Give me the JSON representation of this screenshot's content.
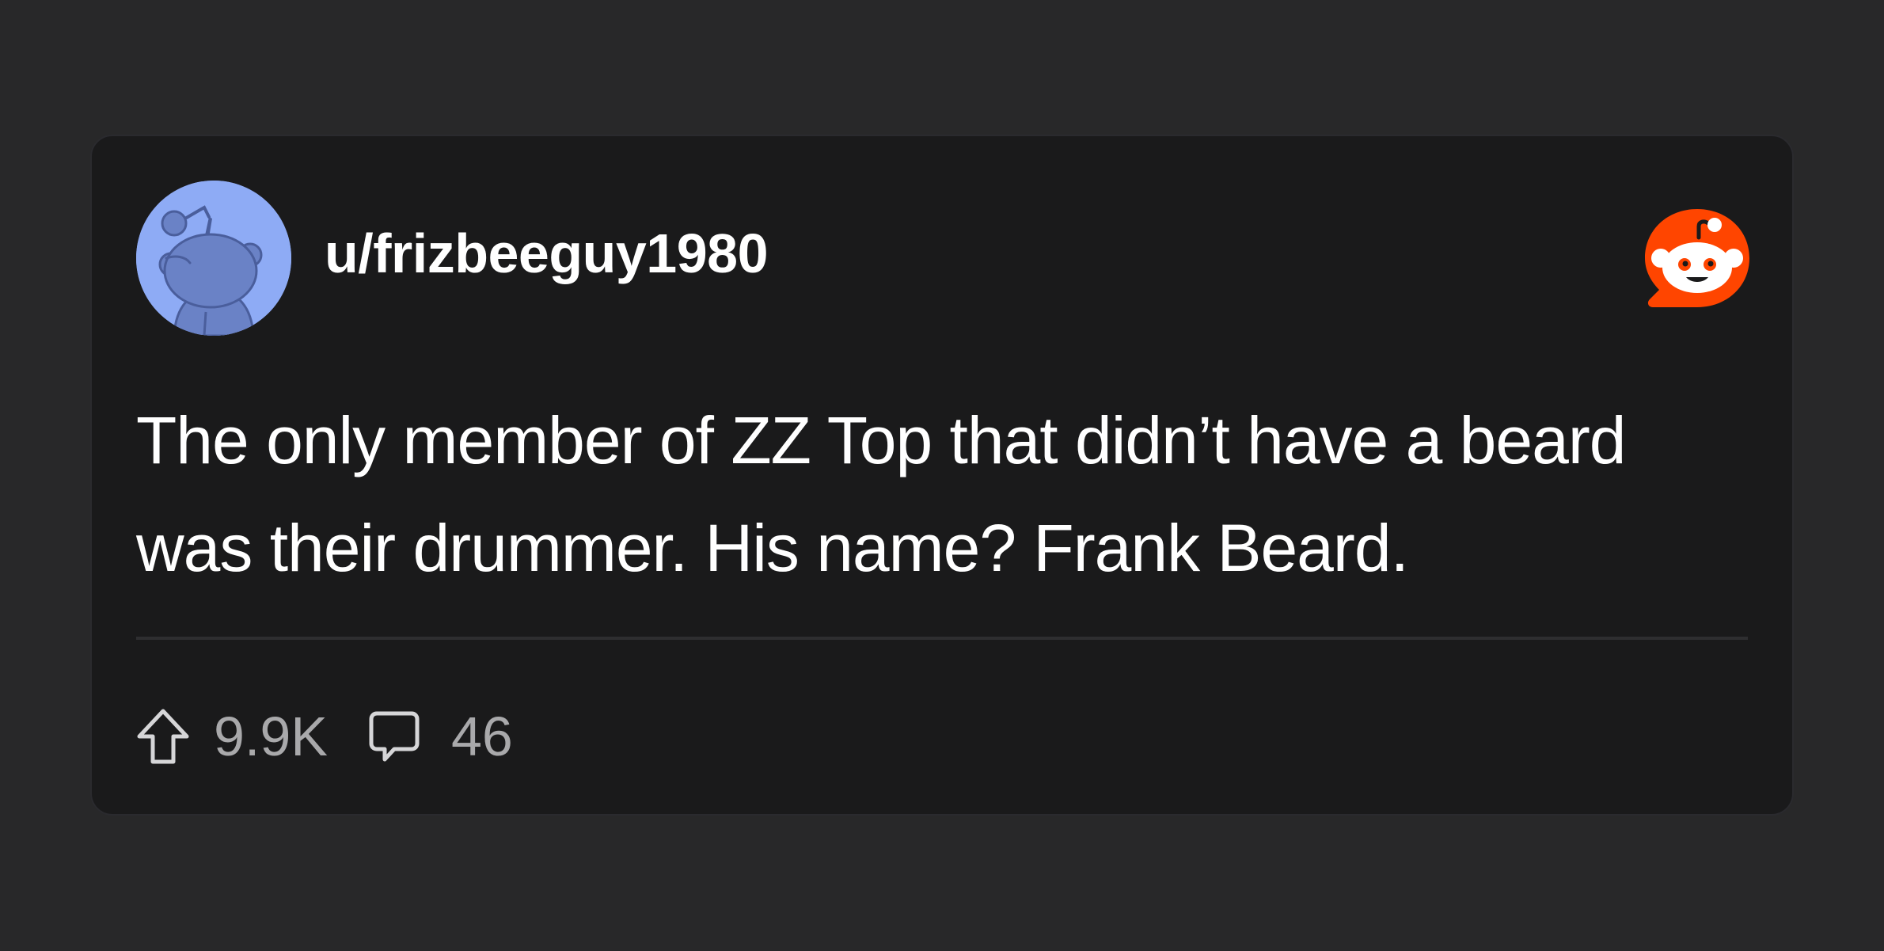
{
  "post": {
    "username": "u/frizbeeguy1980",
    "text": "The only member of ZZ Top that didn’t have a beard was their drummer. His name? Frank Beard.",
    "upvotes": "9.9K",
    "comments": "46"
  },
  "icons": {
    "avatar": "reddit-snoo-avatar",
    "brand": "reddit-logo-icon",
    "upvote": "upvote-arrow-icon",
    "comment": "comment-bubble-icon"
  },
  "colors": {
    "background": "#282829",
    "card": "#1a1a1b",
    "text": "#ffffff",
    "muted": "#a9a9ab",
    "brand": "#ff4500",
    "avatar_bg": "#8eabf5",
    "avatar_fg": "#6a82c6"
  }
}
